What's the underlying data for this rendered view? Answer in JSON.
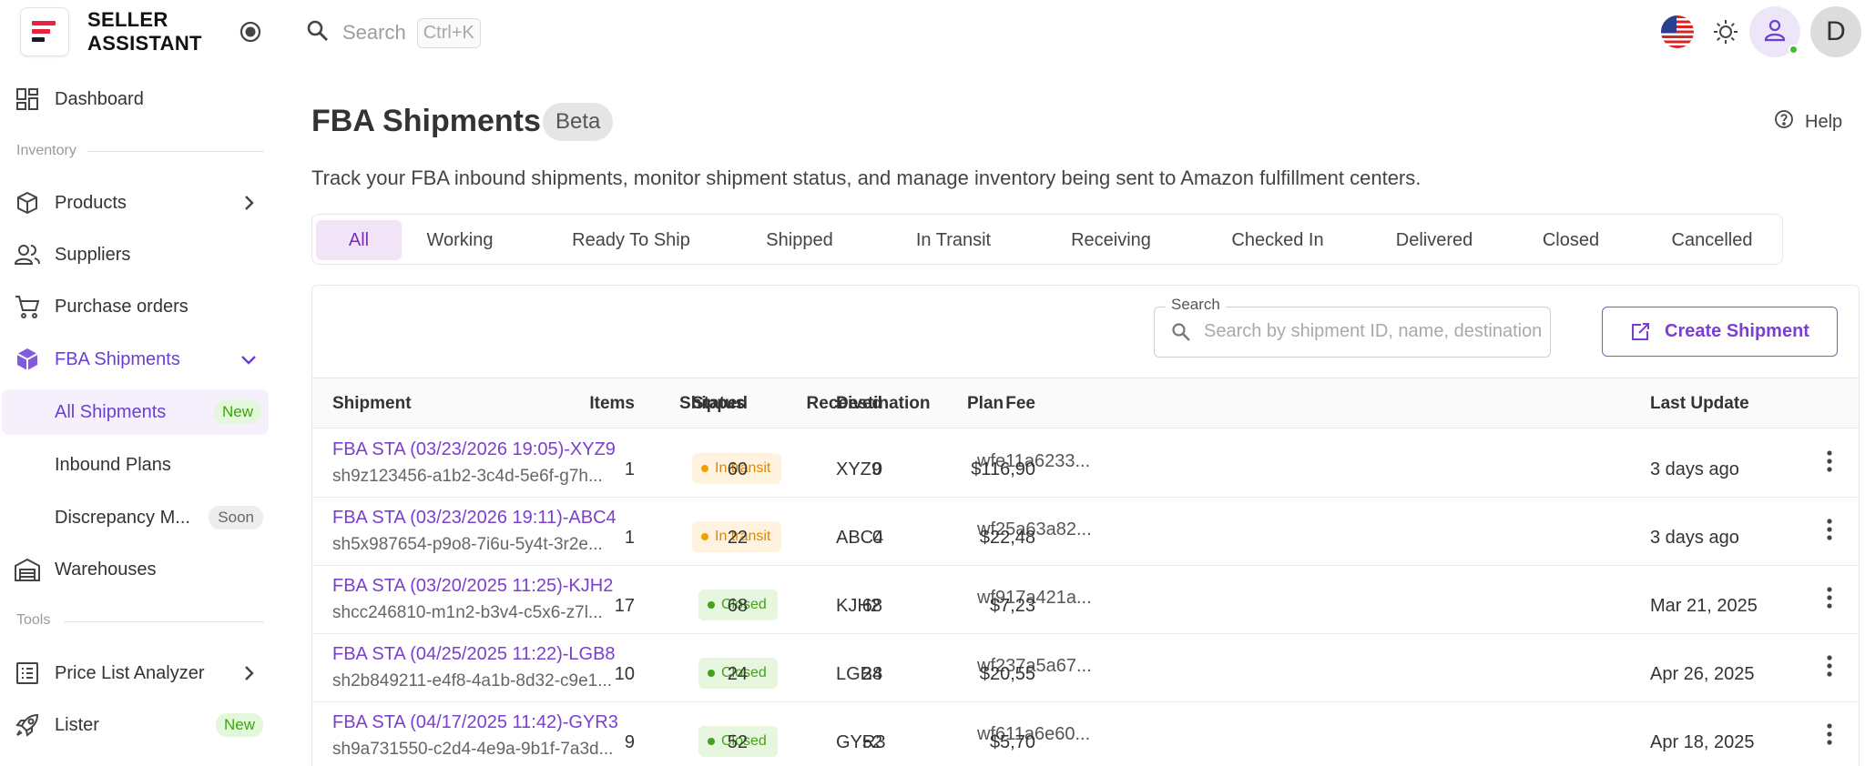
{
  "app": {
    "logo_line1": "SELLER",
    "logo_line2": "ASSISTANT",
    "brand_color": "#e8233b",
    "accent_color": "#6b3fd4"
  },
  "sidebar": {
    "dashboard": "Dashboard",
    "section_inventory": "Inventory",
    "products": "Products",
    "suppliers": "Suppliers",
    "purchase_orders": "Purchase orders",
    "fba_shipments": "FBA Shipments",
    "all_shipments": "All Shipments",
    "all_shipments_badge": "New",
    "inbound_plans": "Inbound Plans",
    "discrepancy": "Discrepancy M...",
    "discrepancy_badge": "Soon",
    "warehouses": "Warehouses",
    "section_tools": "Tools",
    "price_list_analyzer": "Price List Analyzer",
    "lister": "Lister",
    "lister_badge": "New"
  },
  "topbar": {
    "search_placeholder": "Search",
    "shortcut": "Ctrl+K",
    "avatar_letter": "D"
  },
  "header": {
    "title": "FBA Shipments",
    "badge": "Beta",
    "help": "Help",
    "description": "Track your FBA inbound shipments, monitor shipment status, and manage inventory being sent to Amazon fulfillment centers."
  },
  "tabs": [
    "All",
    "Working",
    "Ready To Ship",
    "Shipped",
    "In Transit",
    "Receiving",
    "Checked In",
    "Delivered",
    "Closed",
    "Cancelled"
  ],
  "active_tab": "All",
  "table": {
    "search_label": "Search",
    "search_placeholder": "Search by shipment ID, name, destination",
    "create_button": "Create Shipment",
    "columns": {
      "shipment": "Shipment",
      "status": "Status",
      "destination": "Destination",
      "plan": "Plan",
      "items": "Items",
      "shipped": "Shipped",
      "received": "Received",
      "fee": "Fee",
      "last_update": "Last Update"
    },
    "rows": [
      {
        "name": "FBA STA (03/23/2026 19:05)-XYZ9",
        "id": "sh9z123456-a1b2-3c4d-5e6f-g7h...",
        "status": "In transit",
        "status_kind": "transit",
        "destination": "XYZ9",
        "plan": "wfe11a6233...",
        "items": "1",
        "shipped": "60",
        "received": "0",
        "fee": "$116,90",
        "last_update": "3 days ago"
      },
      {
        "name": "FBA STA (03/23/2026 19:11)-ABC4",
        "id": "sh5x987654-p9o8-7i6u-5y4t-3r2e...",
        "status": "In transit",
        "status_kind": "transit",
        "destination": "ABC4",
        "plan": "wf25a63a82...",
        "items": "1",
        "shipped": "22",
        "received": "0",
        "fee": "$22,48",
        "last_update": "3 days ago"
      },
      {
        "name": "FBA STA (03/20/2025 11:25)-KJH2",
        "id": "shcc246810-m1n2-b3v4-c5x6-z7l...",
        "status": "Closed",
        "status_kind": "closed",
        "destination": "KJH2",
        "plan": "wf917a421a...",
        "items": "17",
        "shipped": "68",
        "received": "68",
        "fee": "$7,23",
        "last_update": "Mar 21, 2025"
      },
      {
        "name": "FBA STA (04/25/2025 11:22)-LGB8",
        "id": "sh2b849211-e4f8-4a1b-8d32-c9e1...",
        "status": "Closed",
        "status_kind": "closed",
        "destination": "LGB8",
        "plan": "wf237a5a67...",
        "items": "10",
        "shipped": "24",
        "received": "24",
        "fee": "$20,55",
        "last_update": "Apr 26, 2025"
      },
      {
        "name": "FBA STA (04/17/2025 11:42)-GYR3",
        "id": "sh9a731550-c2d4-4e9a-9b1f-7a3d...",
        "status": "Closed",
        "status_kind": "closed",
        "destination": "GYR3",
        "plan": "wf611a6e60...",
        "items": "9",
        "shipped": "52",
        "received": "52",
        "fee": "$5,70",
        "last_update": "Apr 18, 2025"
      }
    ]
  },
  "icons": {
    "logo": "seller-assistant-logo",
    "toggle": "radio-dot-icon",
    "search": "search-icon",
    "flag": "us-flag-icon",
    "theme": "sun-icon",
    "user": "user-icon",
    "help": "help-circle-icon",
    "create": "open-external-icon",
    "more": "more-vertical-icon"
  }
}
